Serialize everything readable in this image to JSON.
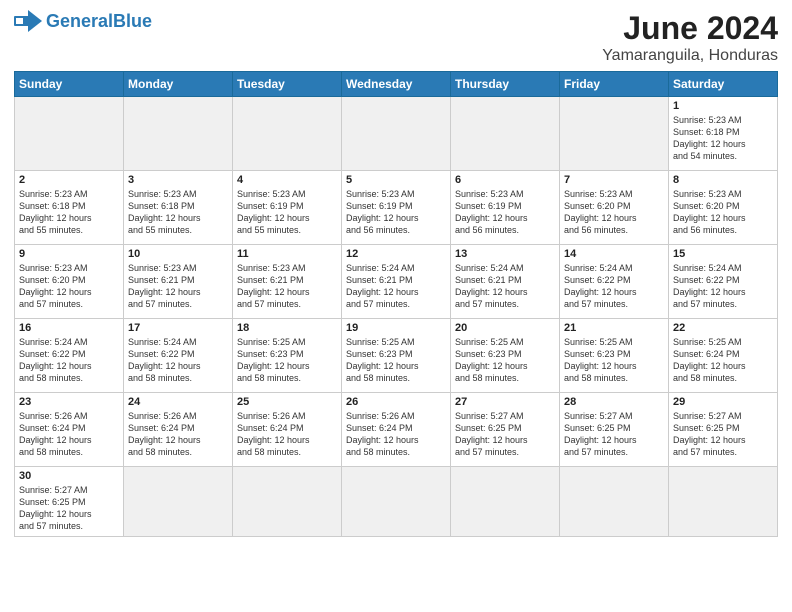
{
  "logo": {
    "text_general": "General",
    "text_blue": "Blue"
  },
  "title": "June 2024",
  "subtitle": "Yamaranguila, Honduras",
  "days_of_week": [
    "Sunday",
    "Monday",
    "Tuesday",
    "Wednesday",
    "Thursday",
    "Friday",
    "Saturday"
  ],
  "weeks": [
    [
      {
        "num": "",
        "info": "",
        "empty": true
      },
      {
        "num": "",
        "info": "",
        "empty": true
      },
      {
        "num": "",
        "info": "",
        "empty": true
      },
      {
        "num": "",
        "info": "",
        "empty": true
      },
      {
        "num": "",
        "info": "",
        "empty": true
      },
      {
        "num": "",
        "info": "",
        "empty": true
      },
      {
        "num": "1",
        "info": "Sunrise: 5:23 AM\nSunset: 6:18 PM\nDaylight: 12 hours\nand 54 minutes.",
        "empty": false
      }
    ],
    [
      {
        "num": "2",
        "info": "Sunrise: 5:23 AM\nSunset: 6:18 PM\nDaylight: 12 hours\nand 55 minutes.",
        "empty": false
      },
      {
        "num": "3",
        "info": "Sunrise: 5:23 AM\nSunset: 6:18 PM\nDaylight: 12 hours\nand 55 minutes.",
        "empty": false
      },
      {
        "num": "4",
        "info": "Sunrise: 5:23 AM\nSunset: 6:19 PM\nDaylight: 12 hours\nand 55 minutes.",
        "empty": false
      },
      {
        "num": "5",
        "info": "Sunrise: 5:23 AM\nSunset: 6:19 PM\nDaylight: 12 hours\nand 56 minutes.",
        "empty": false
      },
      {
        "num": "6",
        "info": "Sunrise: 5:23 AM\nSunset: 6:19 PM\nDaylight: 12 hours\nand 56 minutes.",
        "empty": false
      },
      {
        "num": "7",
        "info": "Sunrise: 5:23 AM\nSunset: 6:20 PM\nDaylight: 12 hours\nand 56 minutes.",
        "empty": false
      },
      {
        "num": "8",
        "info": "Sunrise: 5:23 AM\nSunset: 6:20 PM\nDaylight: 12 hours\nand 56 minutes.",
        "empty": false
      }
    ],
    [
      {
        "num": "9",
        "info": "Sunrise: 5:23 AM\nSunset: 6:20 PM\nDaylight: 12 hours\nand 57 minutes.",
        "empty": false
      },
      {
        "num": "10",
        "info": "Sunrise: 5:23 AM\nSunset: 6:21 PM\nDaylight: 12 hours\nand 57 minutes.",
        "empty": false
      },
      {
        "num": "11",
        "info": "Sunrise: 5:23 AM\nSunset: 6:21 PM\nDaylight: 12 hours\nand 57 minutes.",
        "empty": false
      },
      {
        "num": "12",
        "info": "Sunrise: 5:24 AM\nSunset: 6:21 PM\nDaylight: 12 hours\nand 57 minutes.",
        "empty": false
      },
      {
        "num": "13",
        "info": "Sunrise: 5:24 AM\nSunset: 6:21 PM\nDaylight: 12 hours\nand 57 minutes.",
        "empty": false
      },
      {
        "num": "14",
        "info": "Sunrise: 5:24 AM\nSunset: 6:22 PM\nDaylight: 12 hours\nand 57 minutes.",
        "empty": false
      },
      {
        "num": "15",
        "info": "Sunrise: 5:24 AM\nSunset: 6:22 PM\nDaylight: 12 hours\nand 57 minutes.",
        "empty": false
      }
    ],
    [
      {
        "num": "16",
        "info": "Sunrise: 5:24 AM\nSunset: 6:22 PM\nDaylight: 12 hours\nand 58 minutes.",
        "empty": false
      },
      {
        "num": "17",
        "info": "Sunrise: 5:24 AM\nSunset: 6:22 PM\nDaylight: 12 hours\nand 58 minutes.",
        "empty": false
      },
      {
        "num": "18",
        "info": "Sunrise: 5:25 AM\nSunset: 6:23 PM\nDaylight: 12 hours\nand 58 minutes.",
        "empty": false
      },
      {
        "num": "19",
        "info": "Sunrise: 5:25 AM\nSunset: 6:23 PM\nDaylight: 12 hours\nand 58 minutes.",
        "empty": false
      },
      {
        "num": "20",
        "info": "Sunrise: 5:25 AM\nSunset: 6:23 PM\nDaylight: 12 hours\nand 58 minutes.",
        "empty": false
      },
      {
        "num": "21",
        "info": "Sunrise: 5:25 AM\nSunset: 6:23 PM\nDaylight: 12 hours\nand 58 minutes.",
        "empty": false
      },
      {
        "num": "22",
        "info": "Sunrise: 5:25 AM\nSunset: 6:24 PM\nDaylight: 12 hours\nand 58 minutes.",
        "empty": false
      }
    ],
    [
      {
        "num": "23",
        "info": "Sunrise: 5:26 AM\nSunset: 6:24 PM\nDaylight: 12 hours\nand 58 minutes.",
        "empty": false
      },
      {
        "num": "24",
        "info": "Sunrise: 5:26 AM\nSunset: 6:24 PM\nDaylight: 12 hours\nand 58 minutes.",
        "empty": false
      },
      {
        "num": "25",
        "info": "Sunrise: 5:26 AM\nSunset: 6:24 PM\nDaylight: 12 hours\nand 58 minutes.",
        "empty": false
      },
      {
        "num": "26",
        "info": "Sunrise: 5:26 AM\nSunset: 6:24 PM\nDaylight: 12 hours\nand 58 minutes.",
        "empty": false
      },
      {
        "num": "27",
        "info": "Sunrise: 5:27 AM\nSunset: 6:25 PM\nDaylight: 12 hours\nand 57 minutes.",
        "empty": false
      },
      {
        "num": "28",
        "info": "Sunrise: 5:27 AM\nSunset: 6:25 PM\nDaylight: 12 hours\nand 57 minutes.",
        "empty": false
      },
      {
        "num": "29",
        "info": "Sunrise: 5:27 AM\nSunset: 6:25 PM\nDaylight: 12 hours\nand 57 minutes.",
        "empty": false
      }
    ],
    [
      {
        "num": "30",
        "info": "Sunrise: 5:27 AM\nSunset: 6:25 PM\nDaylight: 12 hours\nand 57 minutes.",
        "empty": false
      },
      {
        "num": "",
        "info": "",
        "empty": true
      },
      {
        "num": "",
        "info": "",
        "empty": true
      },
      {
        "num": "",
        "info": "",
        "empty": true
      },
      {
        "num": "",
        "info": "",
        "empty": true
      },
      {
        "num": "",
        "info": "",
        "empty": true
      },
      {
        "num": "",
        "info": "",
        "empty": true
      }
    ]
  ]
}
